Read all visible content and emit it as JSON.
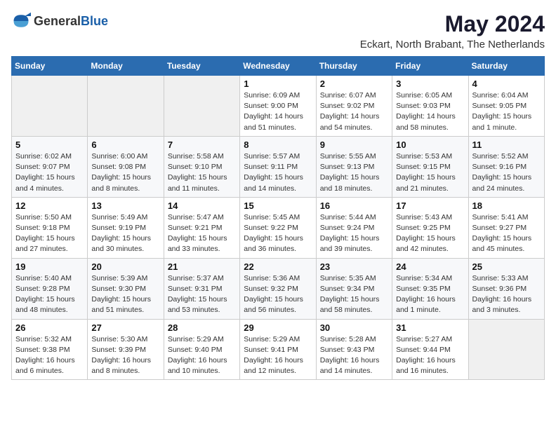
{
  "logo": {
    "general": "General",
    "blue": "Blue"
  },
  "title": "May 2024",
  "subtitle": "Eckart, North Brabant, The Netherlands",
  "days_of_week": [
    "Sunday",
    "Monday",
    "Tuesday",
    "Wednesday",
    "Thursday",
    "Friday",
    "Saturday"
  ],
  "weeks": [
    [
      {
        "day": "",
        "detail": ""
      },
      {
        "day": "",
        "detail": ""
      },
      {
        "day": "",
        "detail": ""
      },
      {
        "day": "1",
        "detail": "Sunrise: 6:09 AM\nSunset: 9:00 PM\nDaylight: 14 hours\nand 51 minutes."
      },
      {
        "day": "2",
        "detail": "Sunrise: 6:07 AM\nSunset: 9:02 PM\nDaylight: 14 hours\nand 54 minutes."
      },
      {
        "day": "3",
        "detail": "Sunrise: 6:05 AM\nSunset: 9:03 PM\nDaylight: 14 hours\nand 58 minutes."
      },
      {
        "day": "4",
        "detail": "Sunrise: 6:04 AM\nSunset: 9:05 PM\nDaylight: 15 hours\nand 1 minute."
      }
    ],
    [
      {
        "day": "5",
        "detail": "Sunrise: 6:02 AM\nSunset: 9:07 PM\nDaylight: 15 hours\nand 4 minutes."
      },
      {
        "day": "6",
        "detail": "Sunrise: 6:00 AM\nSunset: 9:08 PM\nDaylight: 15 hours\nand 8 minutes."
      },
      {
        "day": "7",
        "detail": "Sunrise: 5:58 AM\nSunset: 9:10 PM\nDaylight: 15 hours\nand 11 minutes."
      },
      {
        "day": "8",
        "detail": "Sunrise: 5:57 AM\nSunset: 9:11 PM\nDaylight: 15 hours\nand 14 minutes."
      },
      {
        "day": "9",
        "detail": "Sunrise: 5:55 AM\nSunset: 9:13 PM\nDaylight: 15 hours\nand 18 minutes."
      },
      {
        "day": "10",
        "detail": "Sunrise: 5:53 AM\nSunset: 9:15 PM\nDaylight: 15 hours\nand 21 minutes."
      },
      {
        "day": "11",
        "detail": "Sunrise: 5:52 AM\nSunset: 9:16 PM\nDaylight: 15 hours\nand 24 minutes."
      }
    ],
    [
      {
        "day": "12",
        "detail": "Sunrise: 5:50 AM\nSunset: 9:18 PM\nDaylight: 15 hours\nand 27 minutes."
      },
      {
        "day": "13",
        "detail": "Sunrise: 5:49 AM\nSunset: 9:19 PM\nDaylight: 15 hours\nand 30 minutes."
      },
      {
        "day": "14",
        "detail": "Sunrise: 5:47 AM\nSunset: 9:21 PM\nDaylight: 15 hours\nand 33 minutes."
      },
      {
        "day": "15",
        "detail": "Sunrise: 5:45 AM\nSunset: 9:22 PM\nDaylight: 15 hours\nand 36 minutes."
      },
      {
        "day": "16",
        "detail": "Sunrise: 5:44 AM\nSunset: 9:24 PM\nDaylight: 15 hours\nand 39 minutes."
      },
      {
        "day": "17",
        "detail": "Sunrise: 5:43 AM\nSunset: 9:25 PM\nDaylight: 15 hours\nand 42 minutes."
      },
      {
        "day": "18",
        "detail": "Sunrise: 5:41 AM\nSunset: 9:27 PM\nDaylight: 15 hours\nand 45 minutes."
      }
    ],
    [
      {
        "day": "19",
        "detail": "Sunrise: 5:40 AM\nSunset: 9:28 PM\nDaylight: 15 hours\nand 48 minutes."
      },
      {
        "day": "20",
        "detail": "Sunrise: 5:39 AM\nSunset: 9:30 PM\nDaylight: 15 hours\nand 51 minutes."
      },
      {
        "day": "21",
        "detail": "Sunrise: 5:37 AM\nSunset: 9:31 PM\nDaylight: 15 hours\nand 53 minutes."
      },
      {
        "day": "22",
        "detail": "Sunrise: 5:36 AM\nSunset: 9:32 PM\nDaylight: 15 hours\nand 56 minutes."
      },
      {
        "day": "23",
        "detail": "Sunrise: 5:35 AM\nSunset: 9:34 PM\nDaylight: 15 hours\nand 58 minutes."
      },
      {
        "day": "24",
        "detail": "Sunrise: 5:34 AM\nSunset: 9:35 PM\nDaylight: 16 hours\nand 1 minute."
      },
      {
        "day": "25",
        "detail": "Sunrise: 5:33 AM\nSunset: 9:36 PM\nDaylight: 16 hours\nand 3 minutes."
      }
    ],
    [
      {
        "day": "26",
        "detail": "Sunrise: 5:32 AM\nSunset: 9:38 PM\nDaylight: 16 hours\nand 6 minutes."
      },
      {
        "day": "27",
        "detail": "Sunrise: 5:30 AM\nSunset: 9:39 PM\nDaylight: 16 hours\nand 8 minutes."
      },
      {
        "day": "28",
        "detail": "Sunrise: 5:29 AM\nSunset: 9:40 PM\nDaylight: 16 hours\nand 10 minutes."
      },
      {
        "day": "29",
        "detail": "Sunrise: 5:29 AM\nSunset: 9:41 PM\nDaylight: 16 hours\nand 12 minutes."
      },
      {
        "day": "30",
        "detail": "Sunrise: 5:28 AM\nSunset: 9:43 PM\nDaylight: 16 hours\nand 14 minutes."
      },
      {
        "day": "31",
        "detail": "Sunrise: 5:27 AM\nSunset: 9:44 PM\nDaylight: 16 hours\nand 16 minutes."
      },
      {
        "day": "",
        "detail": ""
      }
    ]
  ]
}
